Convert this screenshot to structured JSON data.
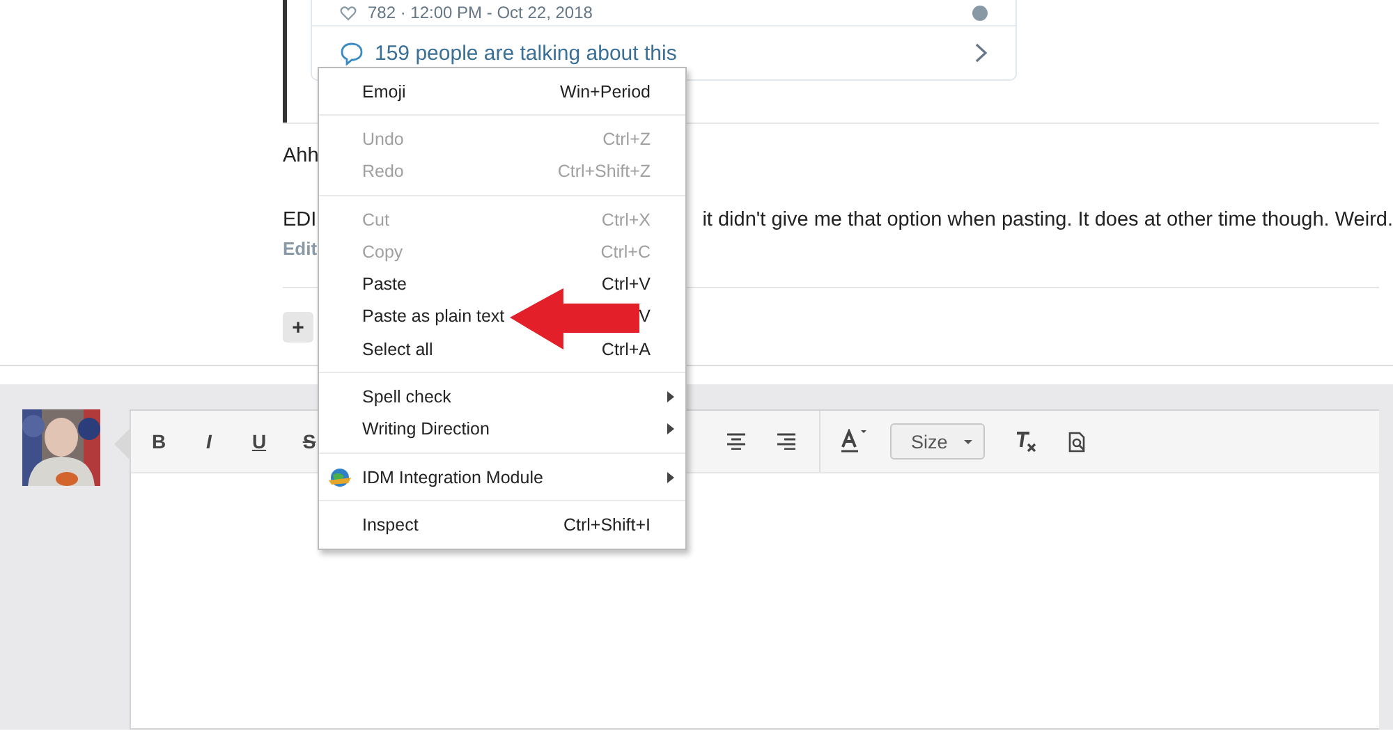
{
  "tweet_card": {
    "meta": "782 · 12:00 PM - Oct 22, 2018",
    "talking_link": "159 people are talking about this"
  },
  "post": {
    "line_1": "Ahh",
    "line_2_start": "EDI",
    "line_2_end": "it didn't give me that option when pasting. It does at other time though. Weird.",
    "edit_link": "Edit",
    "add_button": "+"
  },
  "editor": {
    "toolbar_left": [
      {
        "label": "B",
        "kind": "bold"
      },
      {
        "label": "I",
        "kind": "italic"
      },
      {
        "label": "U",
        "kind": "underline"
      },
      {
        "label": "S",
        "kind": "strike"
      }
    ],
    "size_dropdown": {
      "label": "Size"
    }
  },
  "context_menu": {
    "sections": [
      {
        "items": [
          {
            "label": "Emoji",
            "shortcut": "Win+Period",
            "kind": "command",
            "disabled": false
          }
        ]
      },
      {
        "items": [
          {
            "label": "Undo",
            "shortcut": "Ctrl+Z",
            "kind": "command",
            "disabled": true
          },
          {
            "label": "Redo",
            "shortcut": "Ctrl+Shift+Z",
            "kind": "command",
            "disabled": true
          }
        ]
      },
      {
        "items": [
          {
            "label": "Cut",
            "shortcut": "Ctrl+X",
            "kind": "command",
            "disabled": true
          },
          {
            "label": "Copy",
            "shortcut": "Ctrl+C",
            "kind": "command",
            "disabled": true
          },
          {
            "label": "Paste",
            "shortcut": "Ctrl+V",
            "kind": "command",
            "disabled": false
          },
          {
            "label": "Paste as plain text",
            "shortcut": "V",
            "kind": "command",
            "disabled": false
          },
          {
            "label": "Select all",
            "shortcut": "Ctrl+A",
            "kind": "command",
            "disabled": false
          }
        ]
      },
      {
        "items": [
          {
            "label": "Spell check",
            "kind": "submenu",
            "disabled": false
          },
          {
            "label": "Writing Direction",
            "kind": "submenu",
            "disabled": false
          }
        ]
      },
      {
        "items": [
          {
            "label": "IDM Integration Module",
            "kind": "module",
            "disabled": false
          }
        ]
      },
      {
        "items": [
          {
            "label": "Inspect",
            "shortcut": "Ctrl+Shift+I",
            "kind": "command",
            "disabled": false
          }
        ]
      }
    ]
  }
}
